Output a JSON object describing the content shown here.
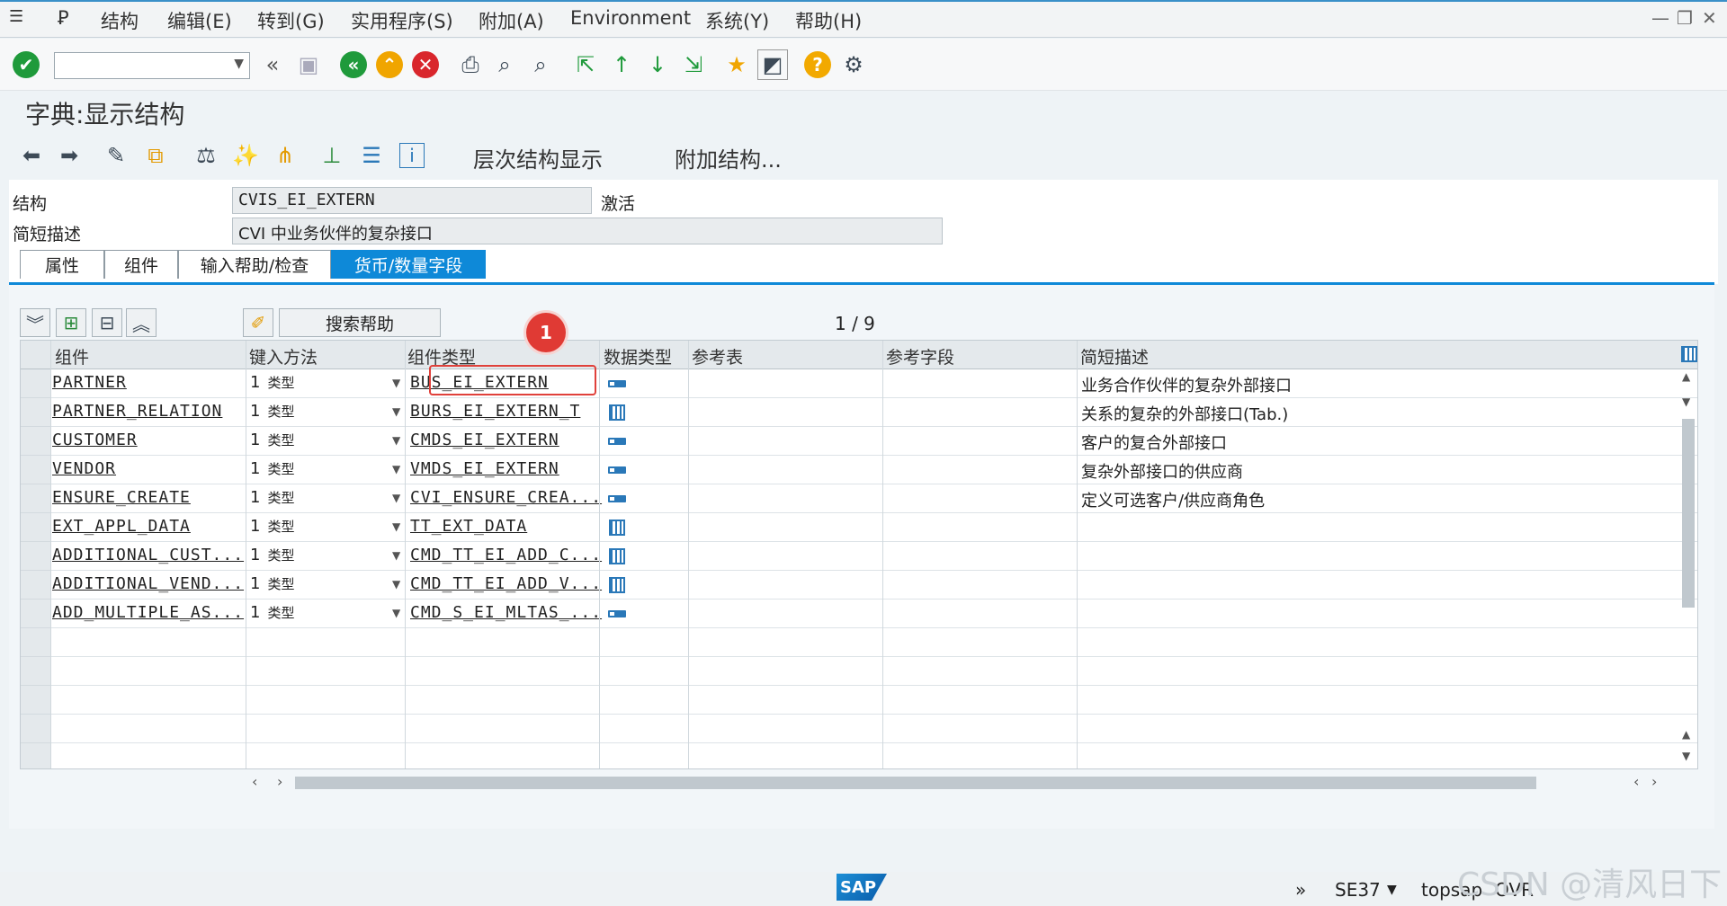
{
  "menu": {
    "items": [
      "结构",
      "编辑(E)",
      "转到(G)",
      "实用程序(S)",
      "附加(A)",
      "Environment",
      "系统(Y)",
      "帮助(H)"
    ]
  },
  "toolbar": {
    "icons": [
      "check-icon",
      "command-field",
      "back-double-icon",
      "save-icon",
      "back-icon",
      "exit-icon",
      "cancel-icon",
      "print-icon",
      "find-icon",
      "find-next-icon",
      "first-page-icon",
      "prev-page-icon",
      "next-page-icon",
      "last-page-icon",
      "create-session-icon",
      "shortcut-icon",
      "help-icon",
      "settings-icon"
    ],
    "colors": {
      "green": "#1f9a3b",
      "orange": "#f0a500",
      "red": "#d9262c",
      "help": "#f2a900"
    }
  },
  "page": {
    "title": "字典:显示结构"
  },
  "app_toolbar": {
    "hierarchy_label": "层次结构显示",
    "append_label": "附加结构..."
  },
  "form": {
    "structure_label": "结构",
    "structure_value": "CVIS_EI_EXTERN",
    "status": "激活",
    "desc_label": "简短描述",
    "desc_value": "CVI 中业务伙伴的复杂接口"
  },
  "tabs": [
    {
      "label": "属性",
      "active": false
    },
    {
      "label": "组件",
      "active": false
    },
    {
      "label": "输入帮助/检查",
      "active": false
    },
    {
      "label": "货币/数量字段",
      "active": true
    }
  ],
  "grid_toolbar": {
    "search_help_label": "搜索帮助",
    "page_counter": "1 / 9",
    "badge": "1"
  },
  "table": {
    "headers": [
      "组件",
      "键入方法",
      "组件类型",
      "数据类型",
      "参考表",
      "参考字段",
      "简短描述"
    ],
    "rows": [
      {
        "component": "PARTNER",
        "typing": "1",
        "typing_label": "类型",
        "comp_type": "BUS_EI_EXTERN",
        "dtype": "elem",
        "desc": "业务合作伙伴的复杂外部接口"
      },
      {
        "component": "PARTNER_RELATION",
        "typing": "1",
        "typing_label": "类型",
        "comp_type": "BURS_EI_EXTERN_T",
        "dtype": "table",
        "desc": "关系的复杂的外部接口(Tab.)"
      },
      {
        "component": "CUSTOMER",
        "typing": "1",
        "typing_label": "类型",
        "comp_type": "CMDS_EI_EXTERN",
        "dtype": "elem",
        "desc": "客户的复合外部接口"
      },
      {
        "component": "VENDOR",
        "typing": "1",
        "typing_label": "类型",
        "comp_type": "VMDS_EI_EXTERN",
        "dtype": "elem",
        "desc": "复杂外部接口的供应商"
      },
      {
        "component": "ENSURE_CREATE",
        "typing": "1",
        "typing_label": "类型",
        "comp_type": "CVI_ENSURE_CREA...",
        "dtype": "elem",
        "desc": "定义可选客户/供应商角色"
      },
      {
        "component": "EXT_APPL_DATA",
        "typing": "1",
        "typing_label": "类型",
        "comp_type": "TT_EXT_DATA",
        "dtype": "table",
        "desc": ""
      },
      {
        "component": "ADDITIONAL_CUST...",
        "typing": "1",
        "typing_label": "类型",
        "comp_type": "CMD_TT_EI_ADD_C...",
        "dtype": "table",
        "desc": ""
      },
      {
        "component": "ADDITIONAL_VEND...",
        "typing": "1",
        "typing_label": "类型",
        "comp_type": "CMD_TT_EI_ADD_V...",
        "dtype": "table",
        "desc": ""
      },
      {
        "component": "ADD_MULTIPLE_AS...",
        "typing": "1",
        "typing_label": "类型",
        "comp_type": "CMD_S_EI_MLTAS_...",
        "dtype": "elem",
        "desc": ""
      }
    ]
  },
  "status_bar": {
    "transaction": "SE37",
    "server": "topsap",
    "mode": "OVR",
    "logo": "SAP",
    "watermark": "CSDN @清风日下"
  }
}
